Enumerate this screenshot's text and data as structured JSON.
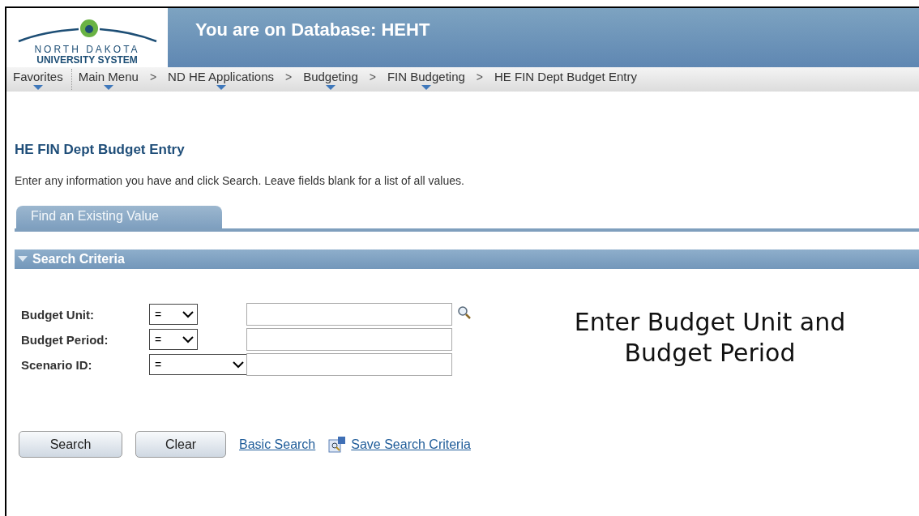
{
  "header": {
    "logo_top": "NORTH DAKOTA",
    "logo_bottom": "UNIVERSITY SYSTEM",
    "title": "You are on Database: HEHT"
  },
  "nav": [
    {
      "label": "Favorites",
      "kind": "menu"
    },
    {
      "label": "Main Menu",
      "kind": "menu"
    },
    {
      "label": "ND HE Applications",
      "kind": "menu",
      "separator": ">"
    },
    {
      "label": "Budgeting",
      "kind": "menu",
      "separator": ">"
    },
    {
      "label": "FIN Budgeting",
      "kind": "menu",
      "separator": ">"
    },
    {
      "label": "HE FIN Dept Budget Entry",
      "kind": "page",
      "separator": ">"
    }
  ],
  "page_title": "HE FIN Dept Budget Entry",
  "instructions": "Enter any information you have and click Search. Leave fields blank for a list of all values.",
  "tabs": [
    {
      "label": "Find an Existing Value",
      "selected": true
    }
  ],
  "section": {
    "title": "Search Criteria",
    "expanded": true
  },
  "fields": [
    {
      "label": "Budget Unit:",
      "operator": "=",
      "kind": "lookup"
    },
    {
      "label": "Budget Period:",
      "operator": "=",
      "kind": "plain"
    },
    {
      "label": "Scenario ID:",
      "operator": "=",
      "kind": "wide"
    }
  ],
  "note": "Enter Budget Unit and Budget Period",
  "buttons": [
    "Search",
    "Clear"
  ],
  "links": [
    {
      "label": "Basic Search",
      "kind": "text"
    },
    {
      "label": "Save Search Criteria",
      "kind": "icon"
    }
  ]
}
